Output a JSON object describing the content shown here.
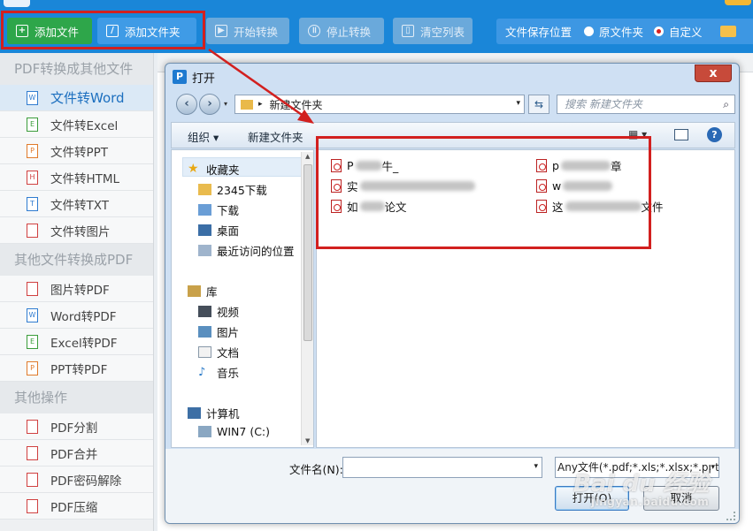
{
  "toolbar": {
    "add_file": "添加文件",
    "add_folder": "添加文件夹",
    "start": "开始转换",
    "stop": "停止转换",
    "clear": "清空列表",
    "save_location": "文件保存位置",
    "original_folder": "原文件夹",
    "custom": "自定义"
  },
  "sidebar": {
    "section1": "PDF转换成其他文件",
    "items1": [
      {
        "label": "文件转Word",
        "icon": "W"
      },
      {
        "label": "文件转Excel",
        "icon": "E"
      },
      {
        "label": "文件转PPT",
        "icon": "P"
      },
      {
        "label": "文件转HTML",
        "icon": "H"
      },
      {
        "label": "文件转TXT",
        "icon": "T"
      },
      {
        "label": "文件转图片",
        "icon": ""
      }
    ],
    "section2": "其他文件转换成PDF",
    "items2": [
      {
        "label": "图片转PDF",
        "icon": ""
      },
      {
        "label": "Word转PDF",
        "icon": "W"
      },
      {
        "label": "Excel转PDF",
        "icon": "E"
      },
      {
        "label": "PPT转PDF",
        "icon": "P"
      }
    ],
    "section3": "其他操作",
    "items3": [
      {
        "label": "PDF分割",
        "icon": ""
      },
      {
        "label": "PDF合并",
        "icon": ""
      },
      {
        "label": "PDF密码解除",
        "icon": ""
      },
      {
        "label": "PDF压缩",
        "icon": ""
      }
    ]
  },
  "dialog": {
    "title": "打开",
    "close": "x",
    "address": "新建文件夹",
    "search_placeholder": "搜索 新建文件夹",
    "organize": "组织 ▾",
    "new_folder": "新建文件夹",
    "nav": {
      "favorites": "收藏夹",
      "download_2345": "2345下载",
      "downloads": "下载",
      "desktop": "桌面",
      "recent": "最近访问的位置",
      "libraries": "库",
      "videos": "视频",
      "pictures": "图片",
      "documents": "文档",
      "music": "音乐",
      "computer": "计算机",
      "drive_c": "WIN7 (C:)"
    },
    "files": [
      {
        "prefix": "P",
        "suffix": "牛_"
      },
      {
        "prefix": "p",
        "suffix": "章"
      },
      {
        "prefix": "实",
        "suffix": ""
      },
      {
        "prefix": "w",
        "suffix": ""
      },
      {
        "prefix": "如",
        "suffix": "论文"
      },
      {
        "prefix": "这",
        "suffix": "文件"
      }
    ],
    "filename_label": "文件名(N):",
    "filename_value": "",
    "filetype": "Any文件(*.pdf;*.xls;*.xlsx;*.ppt",
    "open": "打开(O)",
    "cancel": "取消"
  },
  "watermark": {
    "main": "Bai du 经验",
    "sub": "jingyan.baidu.com"
  },
  "colors": {
    "topbar": "#1a86d8",
    "add_file_green": "#2ea64a",
    "highlight_red": "#d2201f",
    "active_item_text": "#1c6fbf"
  }
}
